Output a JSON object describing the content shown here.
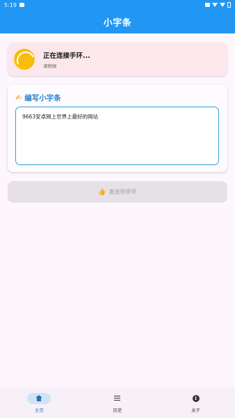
{
  "status_bar": {
    "time": "5:19"
  },
  "app_bar": {
    "title": "小字条"
  },
  "connection": {
    "title": "正在连接手环...",
    "subtitle": "请稍候",
    "spinner_color": "#f7bd0a",
    "card_color": "#fce8ec"
  },
  "write_card": {
    "icon": "writing-hand-icon",
    "icon_glyph": "✍",
    "title": "编写小字条",
    "input_value": "9663安卓网上世界上最好的网站"
  },
  "send_button": {
    "icon": "thumbs-up-icon",
    "icon_glyph": "👍",
    "label": "发送到手环",
    "enabled": false
  },
  "bottom_nav": {
    "items": [
      {
        "label": "主页",
        "icon": "home-icon",
        "active": true
      },
      {
        "label": "历史",
        "icon": "list-icon",
        "active": false
      },
      {
        "label": "关于",
        "icon": "info-icon",
        "active": false
      }
    ]
  },
  "colors": {
    "primary": "#2196f3",
    "accent_text": "#2b83cf",
    "background": "#fdf7fd"
  }
}
